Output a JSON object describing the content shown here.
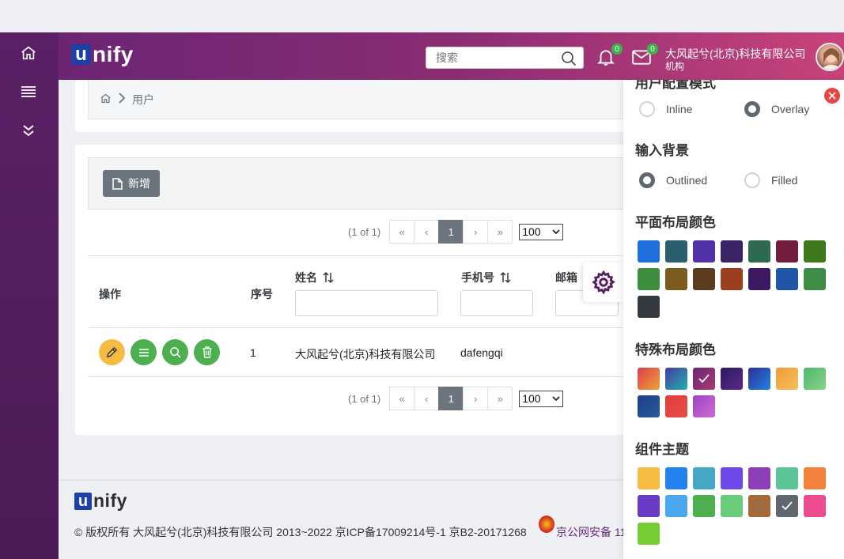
{
  "app": {
    "logo_u": "u",
    "logo_rest": "nify"
  },
  "header": {
    "search_placeholder": "搜索",
    "notifications_count": "0",
    "messages_count": "0",
    "company_name": "大风起兮(北京)科技有限公司",
    "company_type": "机构"
  },
  "breadcrumb": {
    "current": "用户"
  },
  "toolbar": {
    "new_label": "新增"
  },
  "paginator": {
    "report": "(1 of 1)",
    "first": "«",
    "prev": "‹",
    "page": "1",
    "next": "›",
    "last": "»",
    "rows_per_page": "100"
  },
  "table": {
    "headers": {
      "actions": "操作",
      "index": "序号",
      "name": "姓名",
      "phone": "手机号",
      "email": "邮箱"
    },
    "rows": [
      {
        "index": "1",
        "name": "大风起兮(北京)科技有限公司",
        "phone": "dafengqi"
      }
    ]
  },
  "footer": {
    "logo_u": "u",
    "logo_rest": "nify",
    "copyright": "© 版权所有 大风起兮(北京)科技有限公司 2013~2022 京ICP备17009214号-1 京B2-20171268",
    "police_link": "京公网安备 11"
  },
  "config_panel": {
    "menu_mode_title": "用户配置模式",
    "menu_mode_options": [
      "Inline",
      "Overlay"
    ],
    "menu_mode_selected": "Overlay",
    "input_bg_title": "输入背景",
    "input_bg_options": [
      "Outlined",
      "Filled"
    ],
    "input_bg_selected": "Outlined",
    "flat_colors_title": "平面布局颜色",
    "flat_colors": [
      "#1f6fdc",
      "#2b5e6e",
      "#5331a8",
      "#3b2366",
      "#2d6a4f",
      "#721c3e",
      "#3e7a1c",
      "#3c8f3c",
      "#7d5a1d",
      "#5b3c1f",
      "#9b3f1f",
      "#3c1a63",
      "#1f56a8",
      "#3e8e48",
      "#343a40"
    ],
    "special_colors_title": "特殊布局颜色",
    "special_colors": [
      "linear-gradient(135deg,#d9414b,#f0a13a)",
      "linear-gradient(135deg,#4a3aa8,#1fb0a8)",
      "linear-gradient(135deg,#6b2573,#a83a74)",
      "linear-gradient(135deg,#2a1a5e,#5b2a8a)",
      "linear-gradient(135deg,#2d2f9a,#2283e0)",
      "linear-gradient(135deg,#f29b38,#f5c05a)",
      "linear-gradient(135deg,#4db86a,#8ad38a)",
      "linear-gradient(135deg,#1d3f88,#2a5a9a)",
      "linear-gradient(135deg,#e13a3a,#e8504a)",
      "linear-gradient(135deg,#9b44c8,#d06ad0)"
    ],
    "special_selected_index": 2,
    "theme_title": "组件主题",
    "theme_colors": [
      "#f5bb43",
      "#2383ee",
      "#46a7c4",
      "#6f48ec",
      "#8e3fb8",
      "#5bc598",
      "#f0823c",
      "#6a3bc2",
      "#4ba8f0",
      "#4caf50",
      "#68cc78",
      "#a36b3a",
      "#5f6770",
      "#ee4c90",
      "#76cc32"
    ],
    "theme_selected_index": 12
  }
}
